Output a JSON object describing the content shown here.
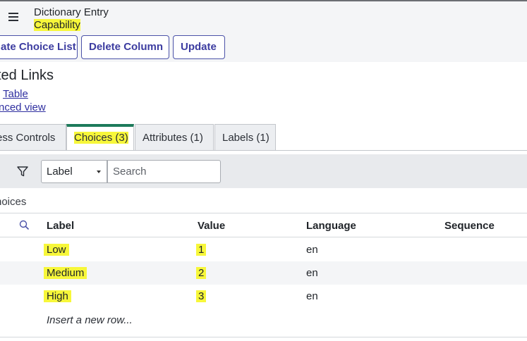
{
  "header": {
    "title": "Dictionary Entry",
    "subtitle": "Capability"
  },
  "toolbar": {
    "buttons": [
      "ate Choice List",
      "Delete Column",
      "Update"
    ]
  },
  "related": {
    "title": "ted Links",
    "links": [
      "Table",
      "nced view"
    ]
  },
  "tabs": [
    {
      "label": "ess Controls"
    },
    {
      "label": "Choices (3)"
    },
    {
      "label": "Attributes (1)"
    },
    {
      "label": "Labels (1)"
    }
  ],
  "filter": {
    "field": "Label",
    "search_placeholder": "Search"
  },
  "list_title": "hoices",
  "table": {
    "columns": [
      "Label",
      "Value",
      "Language",
      "Sequence"
    ],
    "rows": [
      {
        "label": "Low",
        "value": "1",
        "language": "en",
        "sequence": ""
      },
      {
        "label": "Medium",
        "value": "2",
        "language": "en",
        "sequence": ""
      },
      {
        "label": "High",
        "value": "3",
        "language": "en",
        "sequence": ""
      }
    ],
    "insert_label": "Insert a new row..."
  },
  "colors": {
    "accent_tab": "#1d7a5a",
    "highlight": "#f7f73a",
    "button_text": "#3c3ca0"
  }
}
